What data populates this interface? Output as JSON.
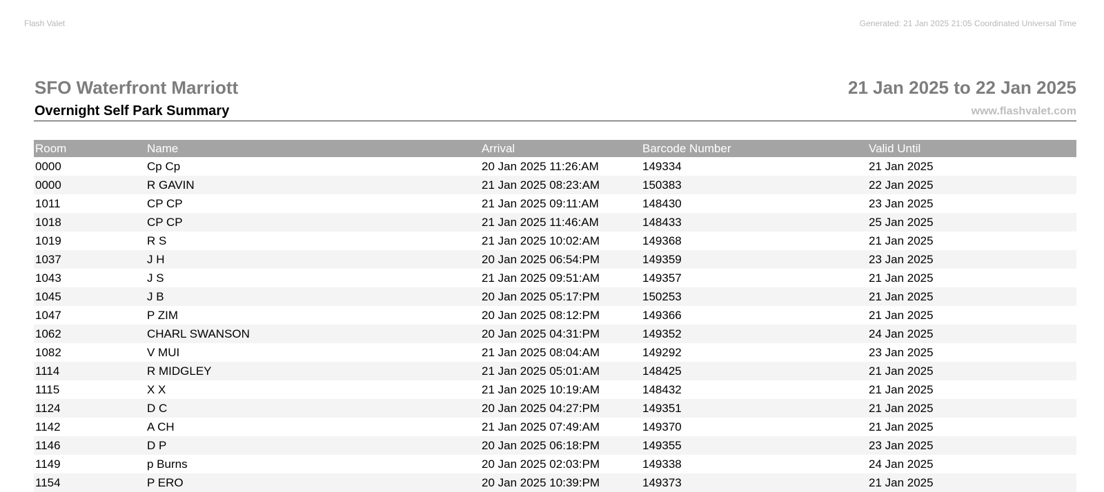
{
  "header": {
    "app_name": "Flash Valet",
    "generated": "Generated: 21 Jan 2025 21:05 Coordinated Universal Time"
  },
  "report": {
    "hotel": "SFO Waterfront Marriott",
    "date_range": "21 Jan 2025 to 22 Jan 2025",
    "title": "Overnight Self Park Summary",
    "website": "www.flashvalet.com"
  },
  "table": {
    "columns": [
      "Room",
      "Name",
      "Arrival",
      "Barcode Number",
      "Valid Until"
    ],
    "rows": [
      [
        "0000",
        "Cp Cp",
        "20 Jan 2025 11:26:AM",
        "149334",
        "21 Jan 2025"
      ],
      [
        "0000",
        "R GAVIN",
        "21 Jan 2025 08:23:AM",
        "150383",
        "22 Jan 2025"
      ],
      [
        "1011",
        "CP CP",
        "21 Jan 2025 09:11:AM",
        "148430",
        "23 Jan 2025"
      ],
      [
        "1018",
        "CP CP",
        "21 Jan 2025 11:46:AM",
        "148433",
        "25 Jan 2025"
      ],
      [
        "1019",
        "R S",
        "21 Jan 2025 10:02:AM",
        "149368",
        "21 Jan 2025"
      ],
      [
        "1037",
        "J H",
        "20 Jan 2025 06:54:PM",
        "149359",
        "23 Jan 2025"
      ],
      [
        "1043",
        "J S",
        "21 Jan 2025 09:51:AM",
        "149357",
        "21 Jan 2025"
      ],
      [
        "1045",
        "J B",
        "20 Jan 2025 05:17:PM",
        "150253",
        "21 Jan 2025"
      ],
      [
        "1047",
        "P ZIM",
        "20 Jan 2025 08:12:PM",
        "149366",
        "21 Jan 2025"
      ],
      [
        "1062",
        "CHARL SWANSON",
        "20 Jan 2025 04:31:PM",
        "149352",
        "24 Jan 2025"
      ],
      [
        "1082",
        "V MUI",
        "21 Jan 2025 08:04:AM",
        "149292",
        "23 Jan 2025"
      ],
      [
        "1114",
        "R MIDGLEY",
        "21 Jan 2025 05:01:AM",
        "148425",
        "21 Jan 2025"
      ],
      [
        "1115",
        "X X",
        "21 Jan 2025 10:19:AM",
        "148432",
        "21 Jan 2025"
      ],
      [
        "1124",
        "D C",
        "20 Jan 2025 04:27:PM",
        "149351",
        "21 Jan 2025"
      ],
      [
        "1142",
        "A CH",
        "21 Jan 2025 07:49:AM",
        "149370",
        "21 Jan 2025"
      ],
      [
        "1146",
        "D P",
        "20 Jan 2025 06:18:PM",
        "149355",
        "23 Jan 2025"
      ],
      [
        "1149",
        "p Burns",
        "20 Jan 2025 02:03:PM",
        "149338",
        "24 Jan 2025"
      ],
      [
        "1154",
        "P ERO",
        "20 Jan 2025 10:39:PM",
        "149373",
        "21 Jan 2025"
      ]
    ]
  }
}
